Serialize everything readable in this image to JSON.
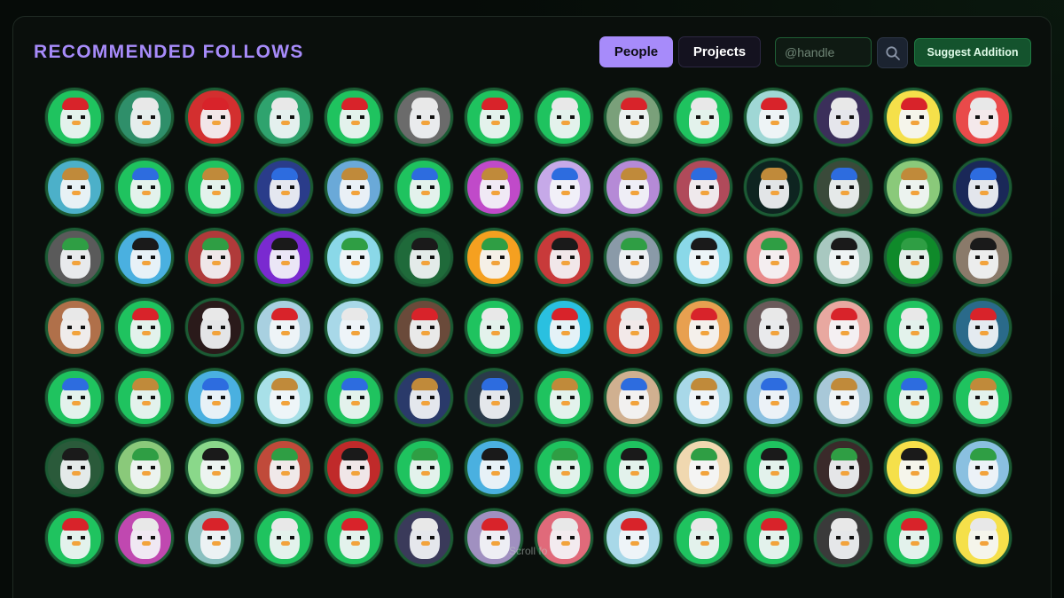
{
  "header": {
    "title": "RECOMMENDED FOLLOWS",
    "tabs": [
      {
        "label": "People",
        "active": true
      },
      {
        "label": "Projects",
        "active": false
      }
    ],
    "handle_placeholder": "@handle",
    "suggest_label": "Suggest Addition"
  },
  "footer": {
    "scroll_hint": "Scroll fo"
  },
  "colors": {
    "accent": "#a78bfa",
    "ring": "#1c5a34",
    "suggest_bg": "#14532d"
  },
  "avatars": [
    [
      "#1fc35f",
      "#2f8f6a",
      "#d32f2f",
      "#2fa36e",
      "#1fc35f",
      "#6b6b6b",
      "#1fc35f",
      "#1fc35f",
      "#7aa07a",
      "#1fc35f",
      "#9fd7d5",
      "#3b2f5a",
      "#f5e04a",
      "#e94a4a"
    ],
    [
      "#4cb0c9",
      "#1fc35f",
      "#1fc35f",
      "#2a3c8a",
      "#6aa9d8",
      "#1fc35f",
      "#c04ac9",
      "#c6a9e8",
      "#b58ad6",
      "#b04a5a",
      "#0e2420",
      "#3a4a3a",
      "#8ac97a",
      "#1a2858"
    ],
    [
      "#5a5a5a",
      "#4ab0e0",
      "#b03a3a",
      "#7a2ad0",
      "#8ad8e8",
      "#1f6a3a",
      "#f5a020",
      "#c83a3a",
      "#8a9aa8",
      "#8ad8e8",
      "#e88a8a",
      "#a8c8c0",
      "#0f8a2a",
      "#8a7a6a"
    ],
    [
      "#b0704a",
      "#1fc35f",
      "#2a1a1a",
      "#a8d0e0",
      "#a8d8e8",
      "#6a4a3a",
      "#1fc35f",
      "#2ac0e0",
      "#d04a3a",
      "#e8a050",
      "#6a5a5a",
      "#e8a8a0",
      "#1fc35f",
      "#2a6a8a"
    ],
    [
      "#1fc35f",
      "#1fc35f",
      "#4ab0e0",
      "#a8e0e8",
      "#1fc35f",
      "#2a3a6a",
      "#2a3a4a",
      "#1fc35f",
      "#d0b090",
      "#a8d8e8",
      "#8ac0e0",
      "#a8c8d8",
      "#1fc35f",
      "#1fc35f"
    ],
    [
      "#2a5a3a",
      "#8ac97a",
      "#8ad88a",
      "#c04a3a",
      "#c02a2a",
      "#1fc35f",
      "#4ab0e0",
      "#1fc35f",
      "#1fc35f",
      "#f0d8b0",
      "#1fc35f",
      "#3a2a2a",
      "#f5e04a",
      "#8ac0e0"
    ],
    [
      "#1fc35f",
      "#c048b0",
      "#8ac0c0",
      "#1fc35f",
      "#1fc35f",
      "#3a3a5a",
      "#a090c0",
      "#e06a7a",
      "#a8d8e8",
      "#1fc35f",
      "#1fc35f",
      "#3a3a3a",
      "#1fc35f",
      "#f5e04a"
    ]
  ]
}
